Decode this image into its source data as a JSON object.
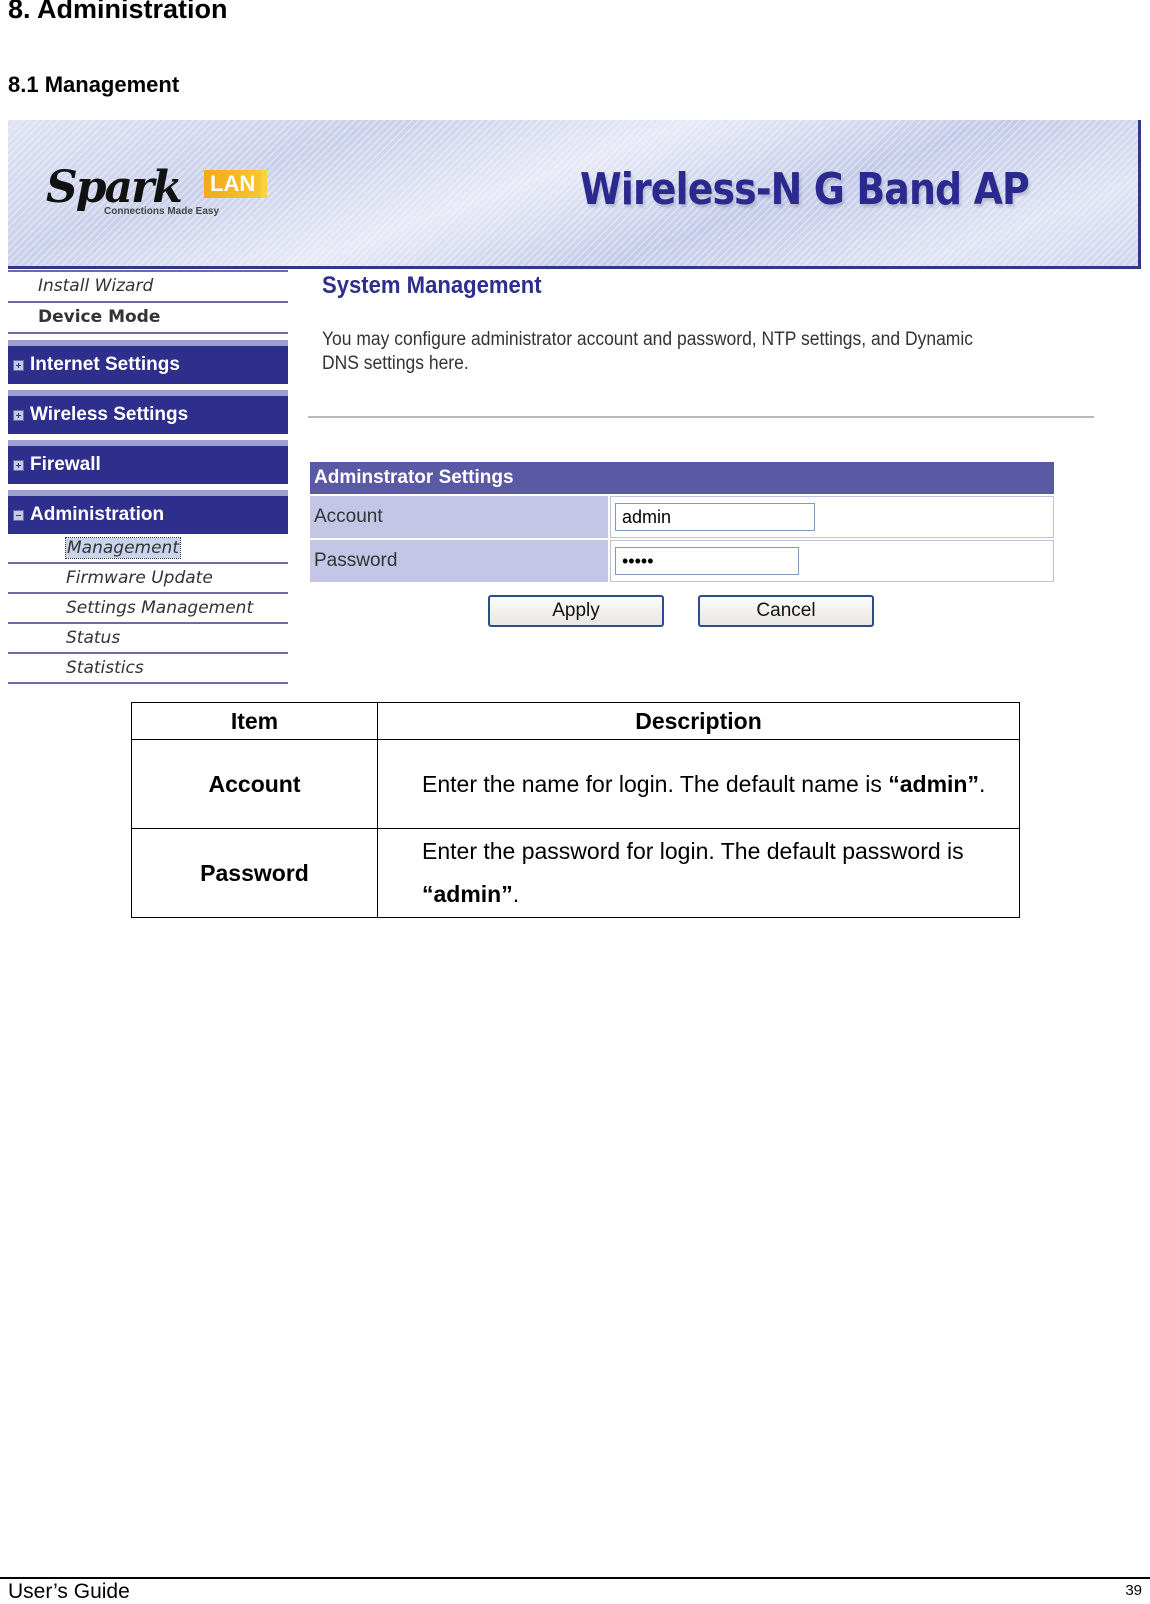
{
  "document": {
    "heading": "8. Administration",
    "subheading": "8.1 Management"
  },
  "banner": {
    "logo_brand": "Spark",
    "logo_lan": "LAN",
    "logo_tagline": "Connections Made Easy",
    "product_title": "Wireless-N G Band AP",
    "accent_color": "#2e2e8c"
  },
  "sidebar": {
    "top_items": [
      {
        "label": "Install Wizard"
      },
      {
        "label": "Device Mode"
      }
    ],
    "groups": [
      {
        "label": "Internet Settings",
        "icon": "plus-icon",
        "expanded": false
      },
      {
        "label": "Wireless Settings",
        "icon": "plus-icon",
        "expanded": false
      },
      {
        "label": "Firewall",
        "icon": "plus-icon",
        "expanded": false
      },
      {
        "label": "Administration",
        "icon": "minus-icon",
        "expanded": true
      }
    ],
    "admin_items": [
      {
        "label": "Management",
        "active": true
      },
      {
        "label": "Firmware Update"
      },
      {
        "label": "Settings Management"
      },
      {
        "label": "Status"
      },
      {
        "label": "Statistics"
      }
    ]
  },
  "main": {
    "title": "System Management",
    "description": "You may configure administrator account and password, NTP settings, and Dynamic DNS settings here.",
    "admin_section": {
      "header": "Adminstrator Settings",
      "account_label": "Account",
      "account_value": "admin",
      "password_label": "Password",
      "password_value": "admin"
    },
    "apply_label": "Apply",
    "cancel_label": "Cancel"
  },
  "table": {
    "headers": [
      "Item",
      "Description"
    ],
    "rows": [
      {
        "item": "Account",
        "desc_prefix": "Enter the name for login. The default name is ",
        "desc_bold": "“admin”",
        "desc_suffix": "."
      },
      {
        "item": "Password",
        "desc_prefix": "Enter the password for login. The default password is ",
        "desc_bold": "“admin”",
        "desc_suffix": "."
      }
    ]
  },
  "footer": {
    "left": "User’s Guide",
    "page_number": "39"
  }
}
